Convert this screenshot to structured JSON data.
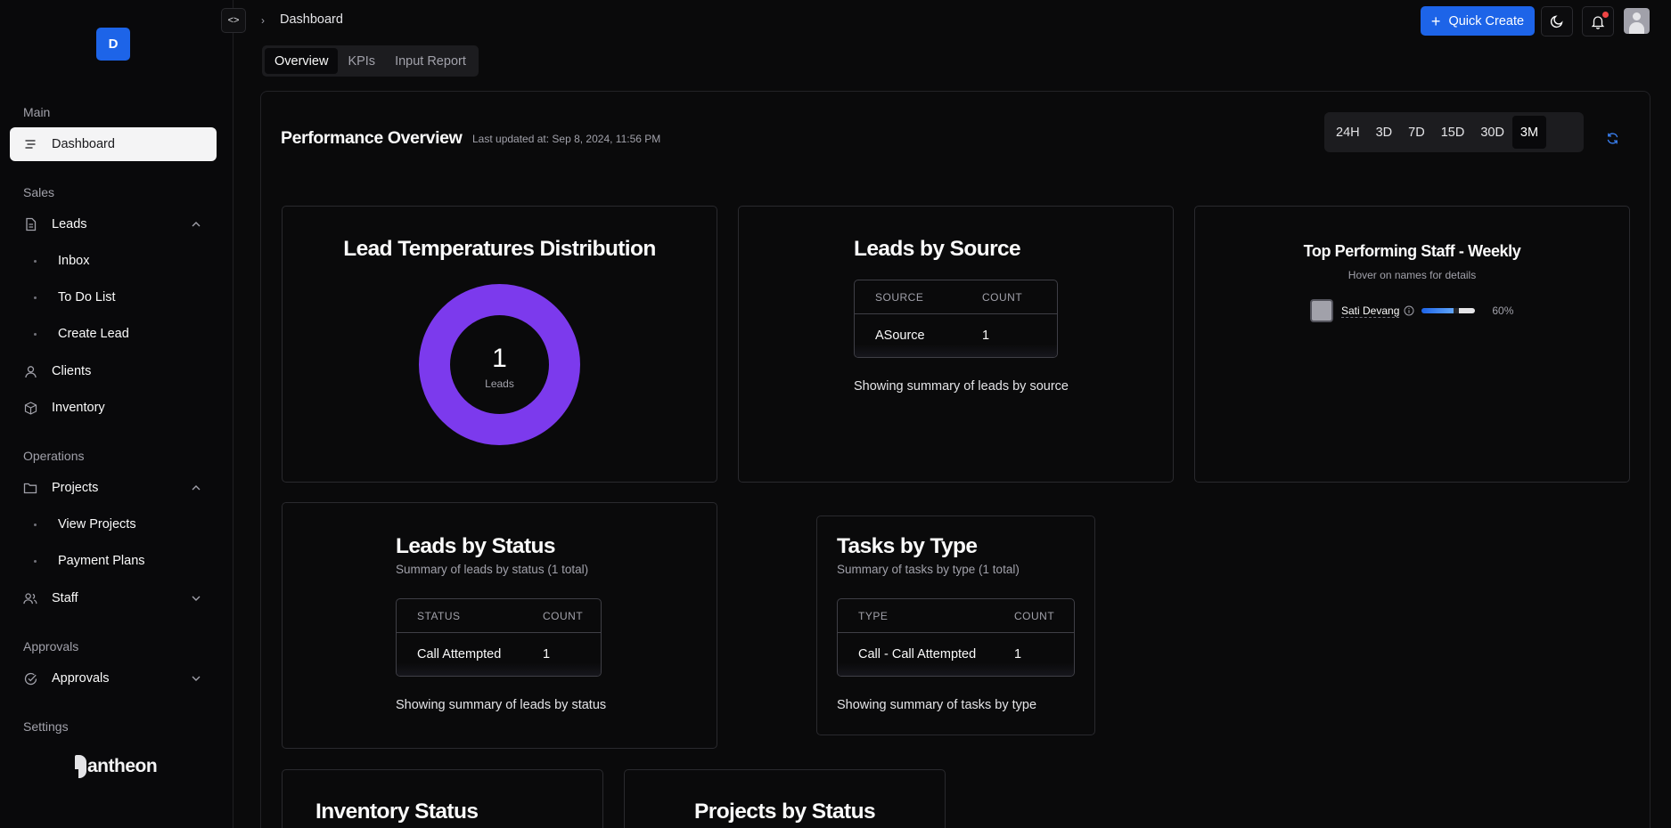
{
  "app": {
    "logo_letter": "D",
    "brand": "antheon"
  },
  "sidebar": {
    "sections": {
      "main": "Main",
      "sales": "Sales",
      "operations": "Operations",
      "approvals": "Approvals",
      "settings": "Settings"
    },
    "items": {
      "dashboard": "Dashboard",
      "leads": "Leads",
      "inbox": "Inbox",
      "todo": "To Do List",
      "create_lead": "Create Lead",
      "clients": "Clients",
      "inventory": "Inventory",
      "projects": "Projects",
      "view_projects": "View Projects",
      "payment_plans": "Payment Plans",
      "staff": "Staff",
      "approvals": "Approvals"
    }
  },
  "header": {
    "breadcrumb": "Dashboard",
    "quick_create": "Quick Create",
    "toggle": "<>"
  },
  "tabs": [
    "Overview",
    "KPIs",
    "Input Report"
  ],
  "performance": {
    "title": "Performance Overview",
    "updated": "Last updated at: Sep 8, 2024, 11:56 PM",
    "ranges": [
      "24H",
      "3D",
      "7D",
      "15D",
      "30D",
      "3M"
    ],
    "active_range": "3M"
  },
  "cards": {
    "temps": {
      "title": "Lead Temperatures Distribution",
      "total": "1",
      "total_label": "Leads",
      "color": "#7c3aed"
    },
    "source": {
      "title": "Leads by Source",
      "headers": [
        "SOURCE",
        "COUNT"
      ],
      "rows": [
        [
          "ASource",
          "1"
        ]
      ],
      "caption": "Showing summary of leads by source"
    },
    "staff": {
      "title": "Top Performing Staff - Weekly",
      "subtitle": "Hover on names for details",
      "name": "Sati Devang",
      "percent_value": 60,
      "percent": "60%"
    },
    "status": {
      "title": "Leads by Status",
      "subtitle": "Summary of leads by status (1 total)",
      "headers": [
        "STATUS",
        "COUNT"
      ],
      "rows": [
        [
          "Call Attempted",
          "1"
        ]
      ],
      "caption": "Showing summary of leads by status"
    },
    "tasks": {
      "title": "Tasks by Type",
      "subtitle": "Summary of tasks by type (1 total)",
      "headers": [
        "TYPE",
        "COUNT"
      ],
      "rows": [
        [
          "Call - Call Attempted",
          "1"
        ]
      ],
      "caption": "Showing summary of tasks by type"
    },
    "inventory": {
      "title": "Inventory Status"
    },
    "projects": {
      "title": "Projects by Status"
    }
  }
}
